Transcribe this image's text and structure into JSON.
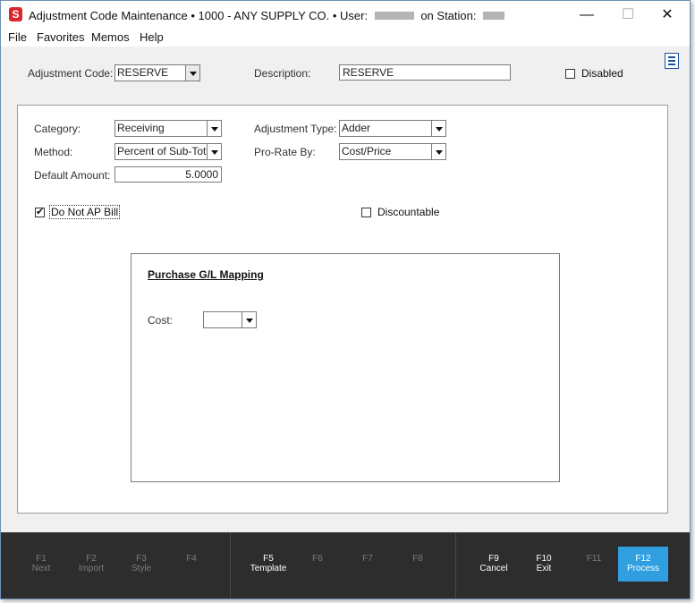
{
  "window": {
    "app_icon_letter": "S",
    "title_prefix": "Adjustment Code Maintenance  •  1000 - ANY SUPPLY CO.  •  User:",
    "title_station": "on Station:",
    "controls": {
      "minimize": "—",
      "maximize": "☐",
      "close": "✕"
    }
  },
  "menu": {
    "items": [
      "File",
      "Favorites",
      "Memos",
      "Help"
    ]
  },
  "header": {
    "adjustment_code_label": "Adjustment Code:",
    "adjustment_code_value": "RESERVE",
    "description_label": "Description:",
    "description_value": "RESERVE",
    "disabled_label": "Disabled",
    "disabled_checked": false
  },
  "form": {
    "category_label": "Category:",
    "category_value": "Receiving",
    "method_label": "Method:",
    "method_value": "Percent of Sub-Total",
    "default_amount_label": "Default Amount:",
    "default_amount_value": "5.0000",
    "adjustment_type_label": "Adjustment Type:",
    "adjustment_type_value": "Adder",
    "prorate_label": "Pro-Rate By:",
    "prorate_value": "Cost/Price",
    "do_not_ap_bill_label": "Do Not AP Bill",
    "do_not_ap_bill_checked": true,
    "do_not_ap_bill_mark": "✔",
    "discountable_label": "Discountable",
    "discountable_checked": false
  },
  "gl_mapping": {
    "title": "Purchase G/L Mapping",
    "cost_label": "Cost:",
    "cost_value": ""
  },
  "function_keys": [
    {
      "key": "F1",
      "label": "Next",
      "enabled": false
    },
    {
      "key": "F2",
      "label": "Import",
      "enabled": false
    },
    {
      "key": "F3",
      "label": "Style",
      "enabled": false
    },
    {
      "key": "F4",
      "label": "",
      "enabled": false
    },
    {
      "key": "F5",
      "label": "Template",
      "enabled": true
    },
    {
      "key": "F6",
      "label": "",
      "enabled": false
    },
    {
      "key": "F7",
      "label": "",
      "enabled": false
    },
    {
      "key": "F8",
      "label": "",
      "enabled": false
    },
    {
      "key": "F9",
      "label": "Cancel",
      "enabled": true
    },
    {
      "key": "F10",
      "label": "Exit",
      "enabled": true
    },
    {
      "key": "F11",
      "label": "",
      "enabled": false
    },
    {
      "key": "F12",
      "label": "Process",
      "enabled": true
    }
  ],
  "colors": {
    "accent": "#2f9fe0",
    "function_bar": "#2d2d2d",
    "app_icon": "#d9262d"
  }
}
